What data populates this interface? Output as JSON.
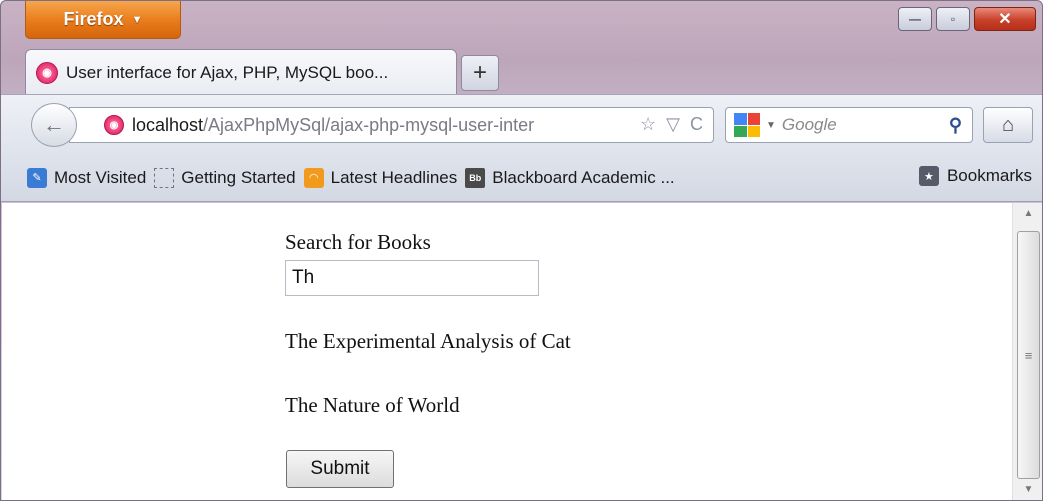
{
  "app": {
    "menu_button": "Firefox",
    "window_controls": {
      "minimize": "—",
      "maximize": "▫",
      "close": "✕"
    }
  },
  "tab": {
    "title": "User interface for Ajax, PHP, MySQL boo...",
    "new_tab": "+",
    "icon": "ajax-site-icon"
  },
  "navigation": {
    "back_icon": "back-arrow-icon",
    "url_host": "localhost",
    "url_path": "/AjaxPhpMySql/ajax-php-mysql-user-inter",
    "search_placeholder": "Google",
    "bookmark_star": "☆",
    "dropdown_caret": "▽",
    "reload": "C",
    "home_icon": "home-icon"
  },
  "bookmarks": {
    "items": [
      {
        "label": "Most Visited",
        "icon": "most-visited-icon"
      },
      {
        "label": "Getting Started",
        "icon": "getting-started-icon"
      },
      {
        "label": "Latest Headlines",
        "icon": "rss-icon"
      },
      {
        "label": "Blackboard Academic ...",
        "icon": "blackboard-icon"
      }
    ],
    "menu_label": "Bookmarks"
  },
  "page": {
    "search_label": "Search for Books",
    "search_value": "Th",
    "results": [
      "The Experimental Analysis of Cat",
      "The Nature of World"
    ],
    "submit_label": "Submit"
  },
  "colors": {
    "firefox_orange": "#e87b1a",
    "close_red": "#c8402a",
    "favicon_pink": "#e8306e"
  }
}
